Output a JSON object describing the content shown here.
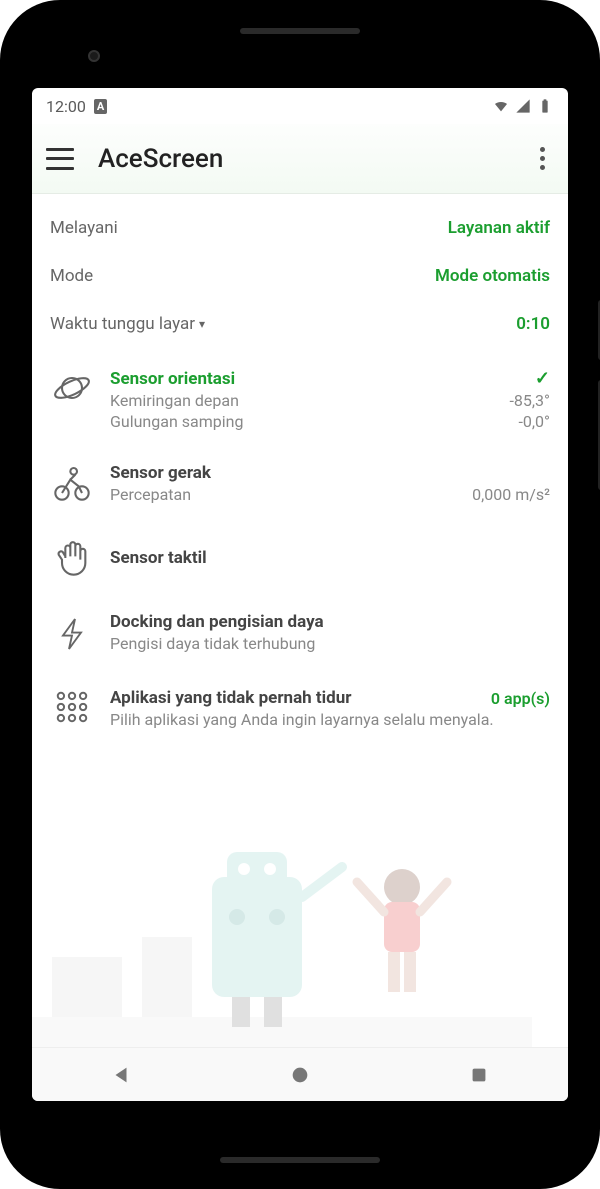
{
  "status": {
    "time": "12:00",
    "text_icon": "A"
  },
  "app": {
    "title": "AceScreen"
  },
  "rows": {
    "service_label": "Melayani",
    "service_value": "Layanan aktif",
    "mode_label": "Mode",
    "mode_value": "Mode otomatis",
    "timeout_label": "Waktu tunggu layar",
    "timeout_caret": "▾",
    "timeout_value": "0:10"
  },
  "sensors": {
    "orientation": {
      "title": "Sensor orientasi",
      "check": "✓",
      "tilt_label": "Kemiringan depan",
      "tilt_value": "-85,3°",
      "roll_label": "Gulungan samping",
      "roll_value": "-0,0°"
    },
    "motion": {
      "title": "Sensor gerak",
      "accel_label": "Percepatan",
      "accel_value": "0,000 m/s²"
    },
    "tactile": {
      "title": "Sensor taktil"
    },
    "docking": {
      "title": "Docking dan pengisian daya",
      "sub": "Pengisi daya tidak terhubung"
    },
    "neversleep": {
      "title": "Aplikasi yang tidak pernah tidur",
      "count": "0 app(s)",
      "sub": "Pilih aplikasi yang Anda ingin layarnya selalu menyala."
    }
  }
}
